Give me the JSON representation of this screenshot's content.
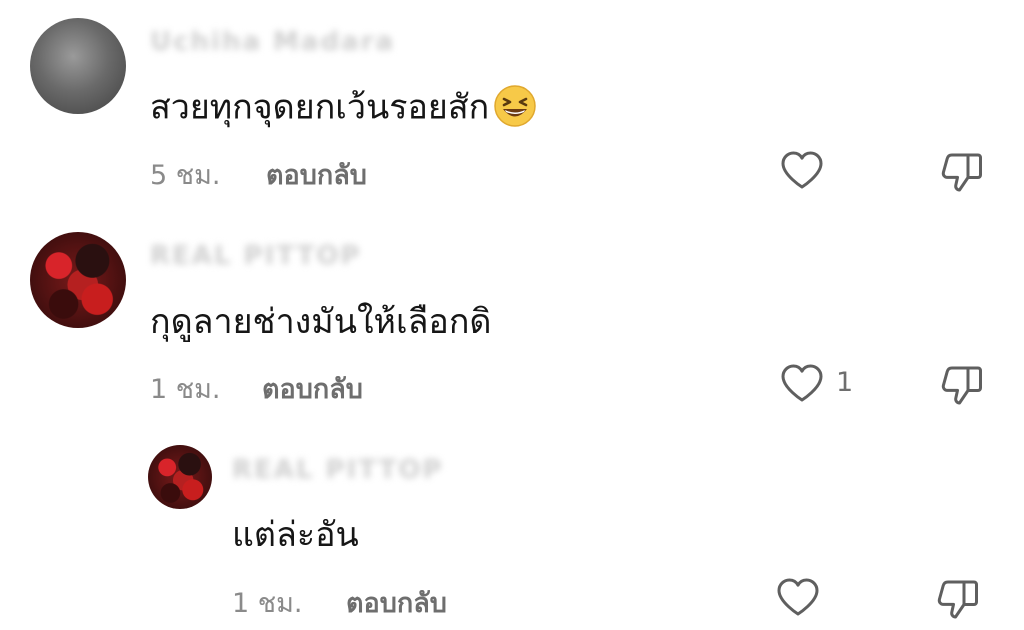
{
  "comments": [
    {
      "username": "Uchiha Madara",
      "text": "สวยทุกจุดยกเว้นรอยสัก",
      "emoji": "grinning-squinting-face",
      "time": "5 ชม.",
      "reply_label": "ตอบกลับ",
      "like_count": ""
    },
    {
      "username": "REAL PITTOP",
      "text": "กุดูลายช่างมันให้เลือกดิ",
      "time": "1 ชม.",
      "reply_label": "ตอบกลับ",
      "like_count": "1"
    },
    {
      "username": "REAL PITTOP",
      "text": "แต่ล่ะอัน",
      "time": "1 ชม.",
      "reply_label": "ตอบกลับ",
      "like_count": "",
      "is_reply": true
    }
  ],
  "icons": {
    "like": "heart-outline-icon",
    "dislike": "thumbs-down-outline-icon"
  },
  "colors": {
    "text": "#161616",
    "meta": "#8a8a8a",
    "reply": "#6e6e6e",
    "icon_stroke": "#5f5f5f"
  }
}
